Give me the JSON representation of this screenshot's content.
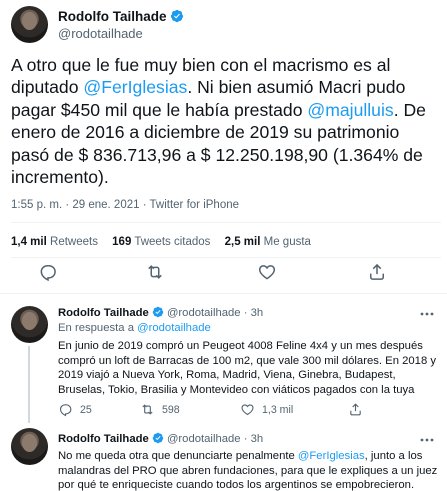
{
  "main_tweet": {
    "author_name": "Rodolfo Tailhade",
    "author_handle": "@rodotailhade",
    "text_before_mention1": "A otro que le fue muy bien con el macrismo es al diputado ",
    "mention1": "@FerIglesias",
    "text_between": ". Ni bien asumió Macri pudo pagar $450 mil que le había prestado ",
    "mention2": "@majulluis",
    "text_after": ". De enero de 2016 a diciembre de 2019 su patrimonio pasó de $ 836.713,96 a $ 12.250.198,90 (1.364% de incremento).",
    "timestamp": "1:55 p. m. · 29 ene. 2021 · Twitter for iPhone",
    "stats": {
      "retweets_count": "1,4 mil",
      "retweets_label": "Retweets",
      "quotes_count": "169",
      "quotes_label": "Tweets citados",
      "likes_count": "2,5 mil",
      "likes_label": "Me gusta"
    }
  },
  "replies": [
    {
      "author_name": "Rodolfo Tailhade",
      "author_handle": "@rodotailhade",
      "time": "· 3h",
      "in_reply_prefix": "En respuesta a ",
      "in_reply_handle": "@rodotailhade",
      "text": "En junio de 2019 compró un Peugeot 4008 Feline 4x4 y un mes después compró un loft de Barracas de 100 m2, que vale 300 mil dólares. En 2018 y 2019 viajó a Nueva York, Roma, Madrid, Viena, Ginebra, Budapest, Bruselas, Tokio, Brasilia y Montevideo con viáticos pagados con la tuya",
      "reply_count": "25",
      "retweet_count": "598",
      "like_count": "1,3 mil"
    },
    {
      "author_name": "Rodolfo Tailhade",
      "author_handle": "@rodotailhade",
      "time": "· 3h",
      "text_before": "No me queda otra que denunciarte penalmente ",
      "mention": "@FerIglesias",
      "text_after": ", junto a los malandras del PRO que abren fundaciones, para que le expliques a un juez por qué te enriqueciste cuando todos los argentinos se empobrecieron."
    }
  ],
  "colors": {
    "link": "#1d9bf0",
    "muted": "#536471",
    "text": "#0f1419",
    "divider": "#eff3f4"
  },
  "icons": [
    "verified-badge-icon",
    "reply-icon",
    "retweet-icon",
    "like-icon",
    "share-icon",
    "more-icon"
  ]
}
